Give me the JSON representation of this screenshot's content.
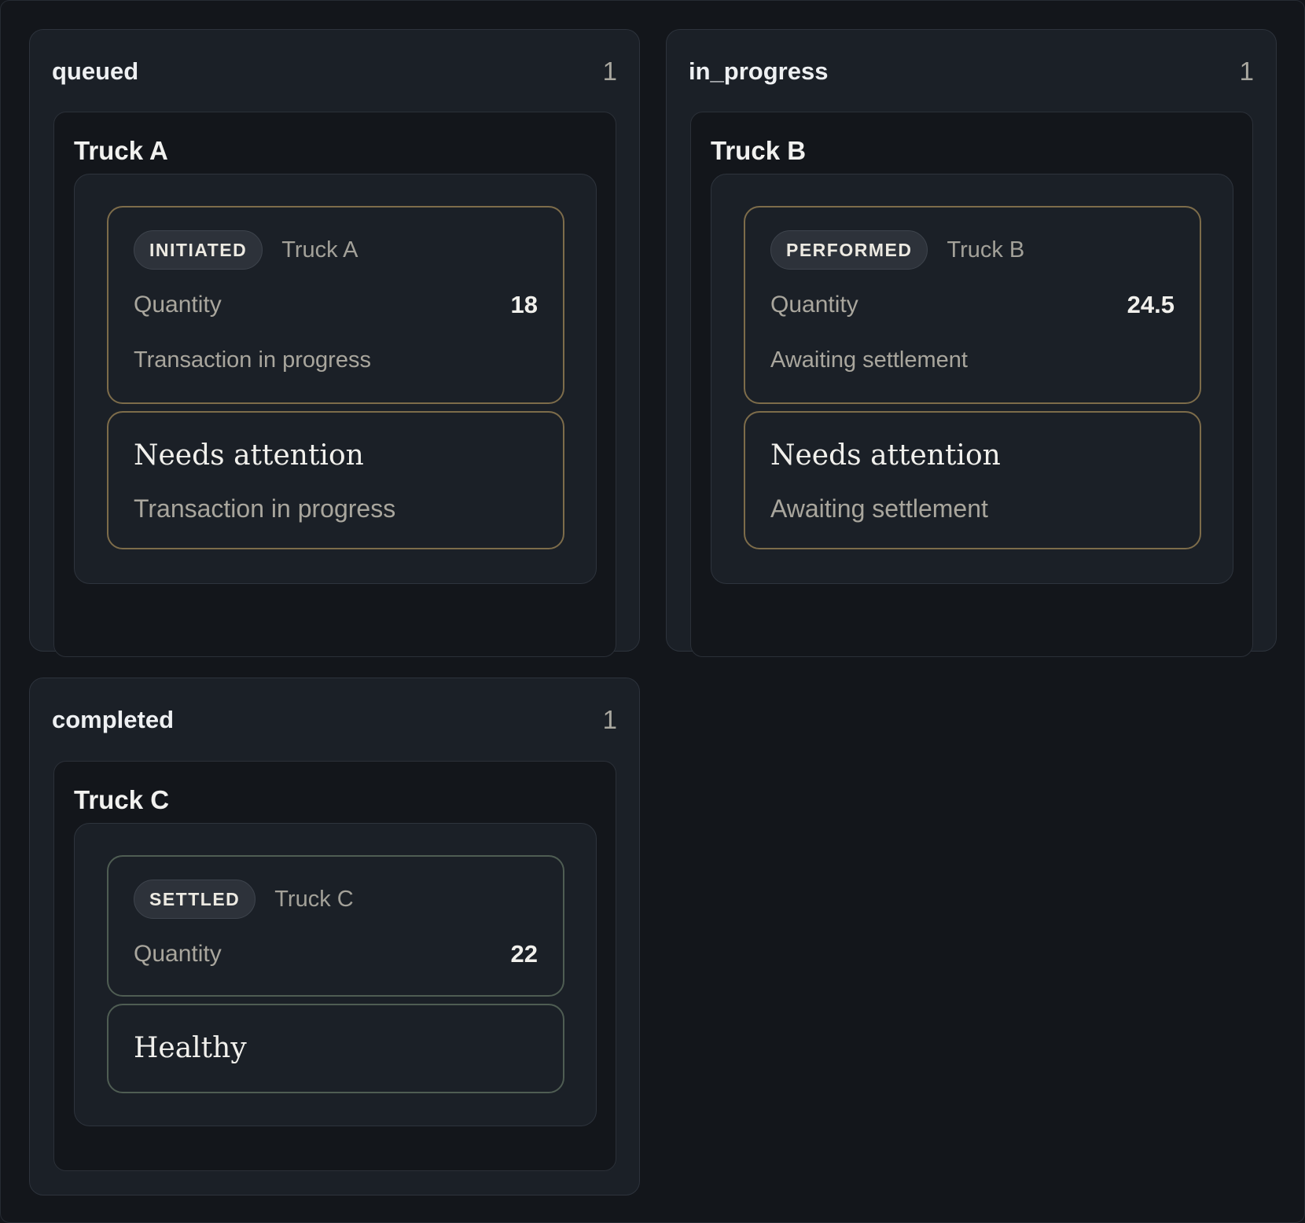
{
  "columns": [
    {
      "title": "queued",
      "count": "1",
      "truck": {
        "title": "Truck A",
        "badge": "INITIATED",
        "name": "Truck A",
        "quantity_label": "Quantity",
        "quantity": "18",
        "note": "Transaction in progress",
        "status_title": "Needs attention",
        "status_detail": "Transaction in progress"
      }
    },
    {
      "title": "in_progress",
      "count": "1",
      "truck": {
        "title": "Truck B",
        "badge": "PERFORMED",
        "name": "Truck B",
        "quantity_label": "Quantity",
        "quantity": "24.5",
        "note": "Awaiting settlement",
        "status_title": "Needs attention",
        "status_detail": "Awaiting settlement"
      }
    },
    {
      "title": "completed",
      "count": "1",
      "truck": {
        "title": "Truck C",
        "badge": "SETTLED",
        "name": "Truck C",
        "quantity_label": "Quantity",
        "quantity": "22",
        "status_title": "Healthy"
      }
    }
  ],
  "colors": {
    "warning_border": "#7d6c4a",
    "healthy_border": "#4f5d53",
    "background": "#13161b",
    "panel": "#1b2027"
  }
}
